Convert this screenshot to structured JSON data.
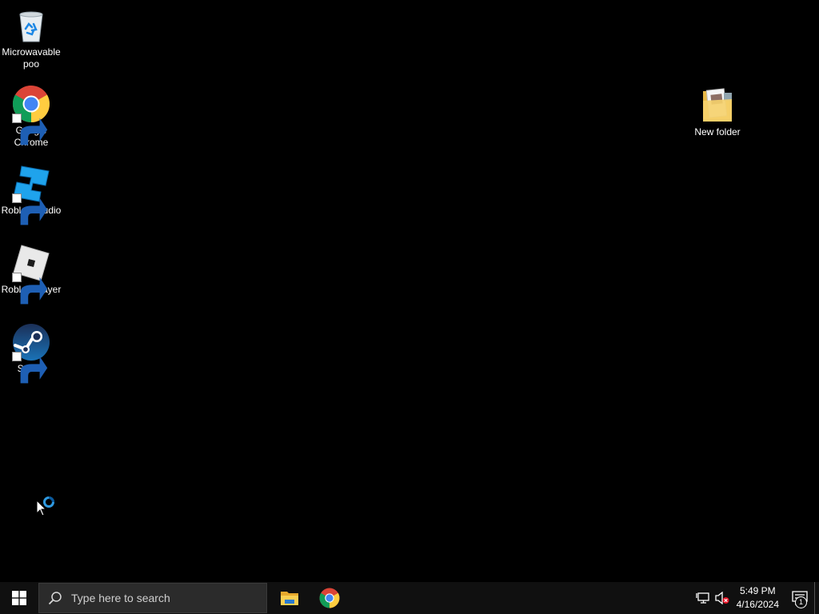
{
  "desktop": {
    "icons": [
      {
        "label": "Microwavable poo",
        "icon": "recycle-bin-icon"
      },
      {
        "label": "Google Chrome",
        "icon": "chrome-icon"
      },
      {
        "label": "Roblox Studio",
        "icon": "roblox-studio-icon"
      },
      {
        "label": "Roblox Player",
        "icon": "roblox-player-icon"
      },
      {
        "label": "Steam",
        "icon": "steam-icon"
      },
      {
        "label": "New folder",
        "icon": "folder-icon"
      }
    ]
  },
  "taskbar": {
    "search_placeholder": "Type here to search",
    "pinned": [
      "file-explorer-icon",
      "chrome-icon"
    ],
    "clock": {
      "time": "5:49 PM",
      "date": "4/16/2024"
    },
    "notification_count": "1"
  },
  "colors": {
    "background": "#000000",
    "taskbar": "#101010",
    "accent": "#0078d7"
  }
}
